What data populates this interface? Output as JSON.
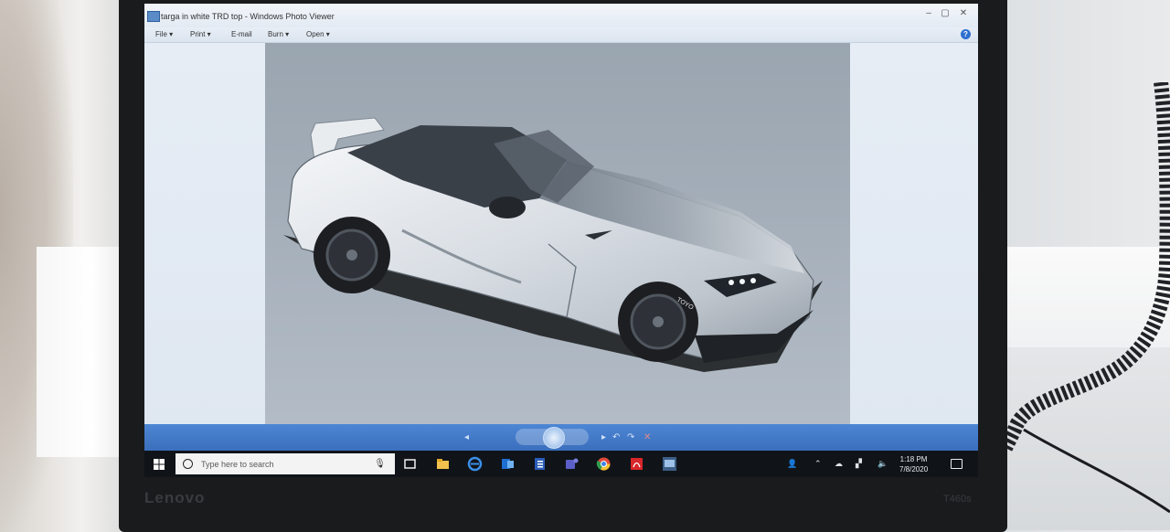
{
  "window": {
    "title": "targa in white TRD top - Windows Photo Viewer",
    "controls": {
      "minimize": "–",
      "maximize": "▢",
      "close": "✕"
    }
  },
  "menu": {
    "file": "File ▾",
    "print": "Print ▾",
    "email": "E-mail",
    "burn": "Burn ▾",
    "open": "Open ▾",
    "help": "?"
  },
  "car": {
    "tire_brand": "TOYO",
    "colors": {
      "body": "#dfe3e8",
      "backdrop": "#a3adb8",
      "tire": "#1c1e22"
    }
  },
  "viewer_controls": {
    "previous": "◂",
    "next": "▸",
    "rotate_ccw": "↶",
    "rotate_cw": "↷",
    "delete": "✕"
  },
  "taskbar": {
    "search_placeholder": "Type here to search",
    "time": "1:18 PM",
    "date": "7/8/2020"
  },
  "laptop": {
    "brand": "Lenovo",
    "model": "T460s"
  }
}
